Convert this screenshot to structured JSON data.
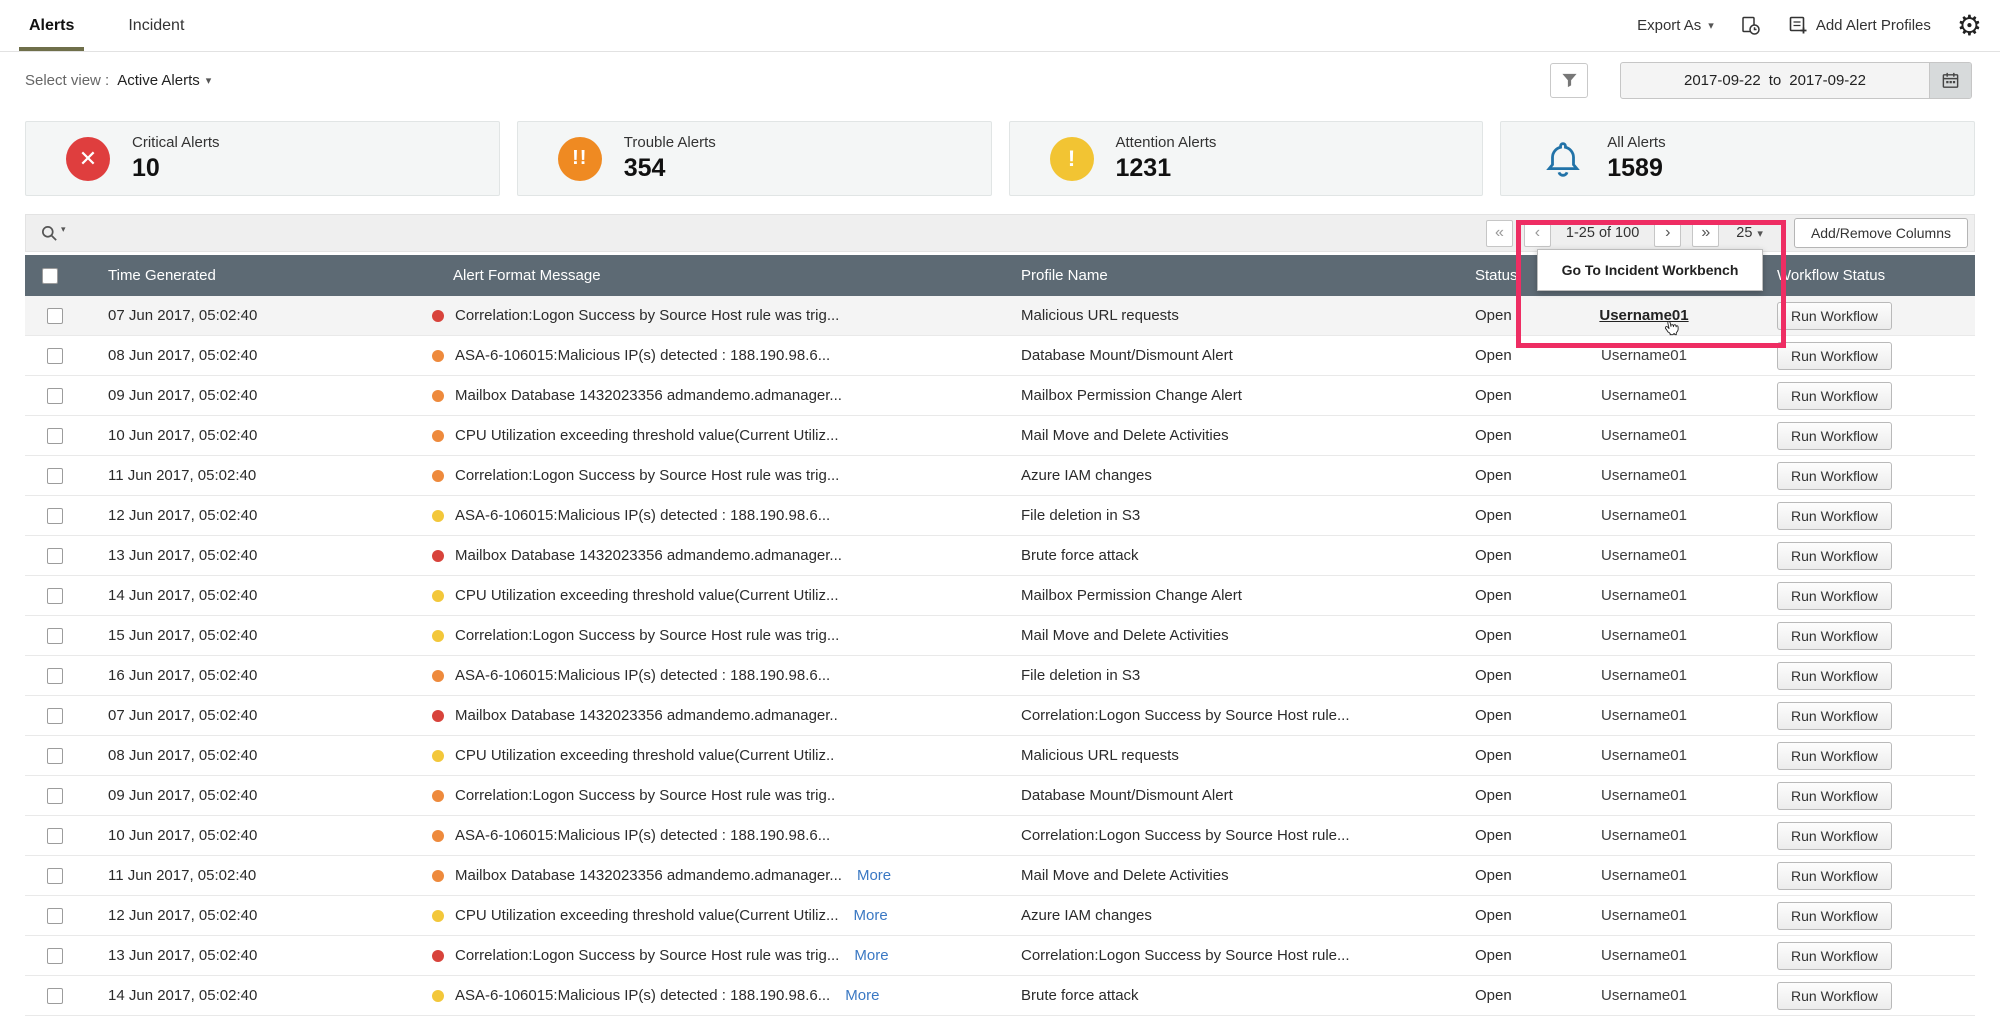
{
  "tabs": {
    "alerts": "Alerts",
    "incident": "Incident"
  },
  "header_actions": {
    "export_as": "Export As",
    "add_alert_profiles": "Add Alert Profiles"
  },
  "view_bar": {
    "label": "Select view :",
    "selected_view": "Active Alerts",
    "date_from": "2017-09-22",
    "date_separator": "to",
    "date_to": "2017-09-22"
  },
  "summary_cards": [
    {
      "label": "Critical Alerts",
      "count": "10"
    },
    {
      "label": "Trouble Alerts",
      "count": "354"
    },
    {
      "label": "Attention Alerts",
      "count": "1231"
    },
    {
      "label": "All Alerts",
      "count": "1589"
    }
  ],
  "colors": {
    "critical": "#df3e3e",
    "trouble": "#ef8a22",
    "attention": "#f2c433",
    "all_alerts_bell": "#2273a8",
    "highlight": "#ee2d63",
    "severity": {
      "red": "#d8433b",
      "orange": "#ee8a3c",
      "yellow": "#f3c73a"
    }
  },
  "toolbar": {
    "first": "«",
    "prev": "‹",
    "next": "›",
    "last": "»",
    "range": "1-25 of 100",
    "page_size": "25",
    "add_remove_columns": "Add/Remove Columns"
  },
  "tooltip": {
    "text": "Go To Incident Workbench"
  },
  "table": {
    "headers": {
      "time": "Time Generated",
      "message": "Alert Format Message",
      "profile": "Profile Name",
      "status": "Status",
      "user": "",
      "workflow": "Workflow Status"
    },
    "more_label": "More",
    "run_workflow_label": "Run Workflow",
    "rows": [
      {
        "time": "07 Jun 2017, 05:02:40",
        "severity": "red",
        "message": "Correlation:Logon Success by Source Host rule was trig...",
        "more": false,
        "profile": "Malicious URL requests",
        "status": "Open",
        "user": "Username01",
        "hovered": true
      },
      {
        "time": "08 Jun 2017, 05:02:40",
        "severity": "orange",
        "message": "ASA-6-106015:Malicious IP(s) detected : 188.190.98.6...",
        "more": false,
        "profile": "Database Mount/Dismount Alert",
        "status": "Open",
        "user": "Username01"
      },
      {
        "time": "09 Jun 2017, 05:02:40",
        "severity": "orange",
        "message": "Mailbox Database 1432023356 admandemo.admanager...",
        "more": false,
        "profile": "Mailbox Permission Change Alert",
        "status": "Open",
        "user": "Username01"
      },
      {
        "time": "10 Jun 2017, 05:02:40",
        "severity": "orange",
        "message": "CPU Utilization exceeding threshold value(Current Utiliz...",
        "more": false,
        "profile": "Mail Move and Delete Activities",
        "status": "Open",
        "user": "Username01"
      },
      {
        "time": "11 Jun 2017, 05:02:40",
        "severity": "orange",
        "message": "Correlation:Logon Success by Source Host rule was trig...",
        "more": false,
        "profile": "Azure IAM changes",
        "status": "Open",
        "user": "Username01"
      },
      {
        "time": "12 Jun 2017, 05:02:40",
        "severity": "yellow",
        "message": "ASA-6-106015:Malicious IP(s) detected : 188.190.98.6...",
        "more": false,
        "profile": "File deletion in S3",
        "status": "Open",
        "user": "Username01"
      },
      {
        "time": "13 Jun 2017, 05:02:40",
        "severity": "red",
        "message": "Mailbox Database 1432023356 admandemo.admanager...",
        "more": false,
        "profile": "Brute force attack",
        "status": "Open",
        "user": "Username01"
      },
      {
        "time": "14 Jun 2017, 05:02:40",
        "severity": "yellow",
        "message": "CPU Utilization exceeding threshold value(Current Utiliz...",
        "more": false,
        "profile": "Mailbox Permission Change Alert",
        "status": "Open",
        "user": "Username01"
      },
      {
        "time": "15 Jun 2017, 05:02:40",
        "severity": "yellow",
        "message": "Correlation:Logon Success by Source Host rule was trig...",
        "more": false,
        "profile": "Mail Move and Delete Activities",
        "status": "Open",
        "user": "Username01"
      },
      {
        "time": "16 Jun 2017, 05:02:40",
        "severity": "orange",
        "message": "ASA-6-106015:Malicious IP(s) detected : 188.190.98.6...",
        "more": false,
        "profile": "File deletion in S3",
        "status": "Open",
        "user": "Username01"
      },
      {
        "time": "07 Jun 2017, 05:02:40",
        "severity": "red",
        "message": "Mailbox Database 1432023356 admandemo.admanager..",
        "more": false,
        "profile": "Correlation:Logon Success by Source Host rule...",
        "status": "Open",
        "user": "Username01"
      },
      {
        "time": "08 Jun 2017, 05:02:40",
        "severity": "yellow",
        "message": "CPU Utilization exceeding threshold value(Current Utiliz..",
        "more": false,
        "profile": "Malicious URL requests",
        "status": "Open",
        "user": "Username01"
      },
      {
        "time": "09 Jun 2017, 05:02:40",
        "severity": "orange",
        "message": "Correlation:Logon Success by Source Host rule was trig..",
        "more": false,
        "profile": "Database Mount/Dismount Alert",
        "status": "Open",
        "user": "Username01"
      },
      {
        "time": "10 Jun 2017, 05:02:40",
        "severity": "orange",
        "message": "ASA-6-106015:Malicious IP(s) detected : 188.190.98.6...",
        "more": false,
        "profile": "Correlation:Logon Success by Source Host rule...",
        "status": "Open",
        "user": "Username01"
      },
      {
        "time": "11 Jun 2017, 05:02:40",
        "severity": "orange",
        "message": "Mailbox Database 1432023356 admandemo.admanager...",
        "more": true,
        "profile": "Mail Move and Delete Activities",
        "status": "Open",
        "user": "Username01"
      },
      {
        "time": "12 Jun 2017, 05:02:40",
        "severity": "yellow",
        "message": "CPU Utilization exceeding threshold value(Current Utiliz...",
        "more": true,
        "profile": "Azure IAM changes",
        "status": "Open",
        "user": "Username01"
      },
      {
        "time": "13 Jun 2017, 05:02:40",
        "severity": "red",
        "message": "Correlation:Logon Success by Source Host rule was trig...",
        "more": true,
        "profile": "Correlation:Logon Success by Source Host rule...",
        "status": "Open",
        "user": "Username01"
      },
      {
        "time": "14 Jun 2017, 05:02:40",
        "severity": "yellow",
        "message": "ASA-6-106015:Malicious IP(s) detected : 188.190.98.6...",
        "more": true,
        "profile": "Brute force attack",
        "status": "Open",
        "user": "Username01"
      }
    ]
  }
}
